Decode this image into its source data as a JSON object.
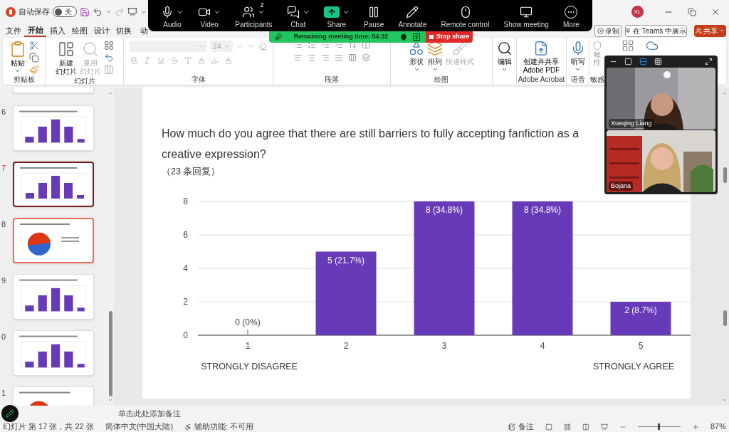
{
  "title_bar": {
    "autosave_label": "自动保存",
    "autosave": {
      "on": false,
      "label": "关"
    },
    "avatar": "XL"
  },
  "menu_tabs": [
    {
      "label": "文件",
      "selected": false
    },
    {
      "label": "开始",
      "selected": true
    },
    {
      "label": "插入",
      "selected": false
    },
    {
      "label": "绘图",
      "selected": false
    },
    {
      "label": "设计",
      "selected": false
    },
    {
      "label": "切换",
      "selected": false
    },
    {
      "label": "动",
      "selected": false
    }
  ],
  "menu_actions": [
    {
      "label": "录制",
      "kind": "record"
    },
    {
      "label": "在 Teams 中展示",
      "kind": "teams"
    },
    {
      "label": "共享",
      "kind": "share"
    }
  ],
  "ribbon": {
    "clipboard": {
      "label": "剪贴板",
      "paste": "粘贴"
    },
    "slides": {
      "label": "幻灯片",
      "new_slide": {
        "lines": [
          "新建",
          "幻灯片"
        ],
        "disabled": false
      },
      "reuse": {
        "lines": [
          "重用",
          "幻灯片"
        ],
        "disabled": true
      }
    },
    "font": {
      "label": "字体",
      "size": "24"
    },
    "paragraph": {
      "label": "段落"
    },
    "drawing": {
      "label": "绘图",
      "buttons": [
        {
          "label": "形状",
          "disabled": false
        },
        {
          "label": "排列",
          "disabled": false
        },
        {
          "label": "快速样式",
          "disabled": true
        }
      ]
    },
    "editing": {
      "button": "编辑"
    },
    "adobe": {
      "label": "Adobe Acrobat",
      "button": [
        "创建并共享",
        "Adobe PDF"
      ]
    },
    "voice": {
      "label": "语音",
      "button": "听写"
    },
    "sensitivity": {
      "label": "敏感",
      "button": [
        "敏",
        "性"
      ]
    }
  },
  "meeting_toolbar": [
    {
      "label": "Audio",
      "kind": "mic",
      "menu": true
    },
    {
      "label": "Video",
      "kind": "camera",
      "menu": true
    },
    {
      "label": "Participants",
      "kind": "people",
      "menu": true,
      "badge": "2"
    },
    {
      "label": "Chat",
      "kind": "chat",
      "menu": true
    },
    {
      "label": "Share",
      "kind": "share",
      "menu": true
    },
    {
      "label": "Pause",
      "kind": "pause",
      "menu": false
    },
    {
      "label": "Annotate",
      "kind": "pen",
      "menu": false
    },
    {
      "label": "Remote control",
      "kind": "mouse",
      "menu": false
    },
    {
      "label": "Show meeting",
      "kind": "screen",
      "menu": false
    },
    {
      "label": "More",
      "kind": "more",
      "menu": false
    }
  ],
  "meeting_bar": {
    "remaining": "Remaining meeting time: 04:32",
    "stop": "Stop share"
  },
  "thumbnails": [
    {
      "number": "6",
      "kind": "bar",
      "selected": false,
      "hovered": false
    },
    {
      "number": "7",
      "kind": "bar",
      "selected": true,
      "hovered": false
    },
    {
      "number": "8",
      "kind": "pie",
      "selected": false,
      "hovered": true
    },
    {
      "number": "9",
      "kind": "bar",
      "selected": false,
      "hovered": false
    },
    {
      "number": "0",
      "kind": "bar",
      "selected": false,
      "hovered": false
    },
    {
      "number": "1",
      "kind": "pie",
      "selected": false,
      "hovered": false
    }
  ],
  "slide": {
    "title_lines": [
      "How much do you agree that there are still barriers to fully accepting fanfiction as a",
      "creative expression?"
    ],
    "responses": "（23 条回复）",
    "chart_data": {
      "type": "bar",
      "categories": [
        "1",
        "2",
        "3",
        "4",
        "5"
      ],
      "values": [
        0,
        5,
        8,
        8,
        2
      ],
      "ylim": [
        0,
        8
      ],
      "yticks": [
        0,
        2,
        4,
        6,
        8
      ],
      "grid": true,
      "value_labels": [
        "0 (0%)",
        "5 (21.7%)",
        "8 (34.8%)",
        "8 (34.8%)",
        "2 (8.7%)"
      ]
    },
    "scale_low": "STRONGLY DISAGREE",
    "scale_high": "STRONGLY AGREE"
  },
  "video_panel": {
    "view_modes": [
      {
        "kind": "minimize",
        "selected": false
      },
      {
        "kind": "single",
        "selected": false
      },
      {
        "kind": "stacked",
        "selected": true
      },
      {
        "kind": "grid",
        "selected": false
      }
    ],
    "participants": [
      {
        "name": "Xueqing Liang"
      },
      {
        "name": "Bojana"
      }
    ]
  },
  "notes": {
    "placeholder": "单击此处添加备注"
  },
  "status_bar": {
    "slide": "幻灯片 第 17 张，共 22 张",
    "language": "简体中文(中国大陆)",
    "accessibility": "辅助功能: 不可用",
    "notes": "备注",
    "zoom_slider": {
      "level": 0.5
    },
    "zoom": "87%"
  }
}
